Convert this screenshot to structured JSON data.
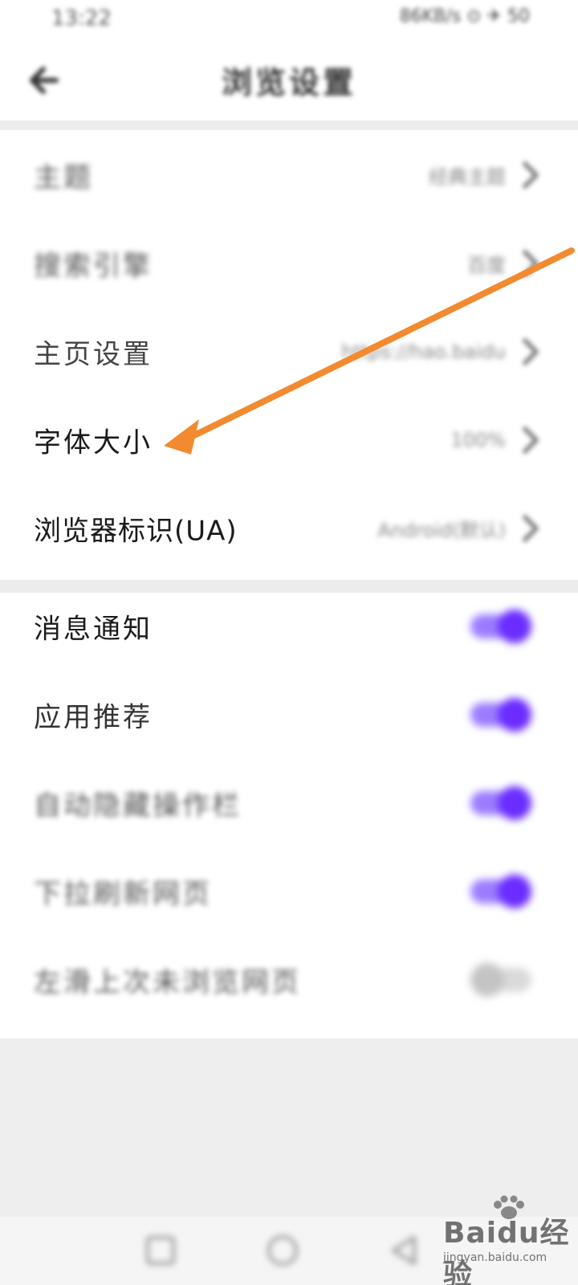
{
  "status_bar": {
    "time": "13:22",
    "icons": "86KB/s ⊙ ✈ 50"
  },
  "header": {
    "title": "浏览设置",
    "back_icon": "back-arrow-icon"
  },
  "settings": {
    "section1": [
      {
        "label": "主题",
        "value": "经典主题",
        "icon": "chevron-right-icon",
        "blurred": true
      },
      {
        "label": "搜索引擎",
        "value": "百度",
        "icon": "chevron-right-icon",
        "blurred": true
      },
      {
        "label": "主页设置",
        "value": "https://hao.baidu",
        "icon": "chevron-right-icon",
        "blurred": false
      },
      {
        "label": "字体大小",
        "value": "100%",
        "icon": "chevron-right-icon",
        "blurred": false
      },
      {
        "label": "浏览器标识(UA)",
        "value": "Android(默认)",
        "icon": "chevron-right-icon",
        "blurred": false
      }
    ],
    "section2": [
      {
        "label": "消息通知",
        "toggle_on": true,
        "blurred": false
      },
      {
        "label": "应用推荐",
        "toggle_on": true,
        "blurred": false
      },
      {
        "label": "自动隐藏操作栏",
        "toggle_on": true,
        "blurred": true
      },
      {
        "label": "下拉刷新网页",
        "toggle_on": true,
        "blurred": true
      },
      {
        "label": "左滑上次未浏览网页",
        "toggle_on": false,
        "blurred": true
      }
    ]
  },
  "navigation": {
    "buttons": [
      "recents-icon",
      "home-icon",
      "back-icon"
    ]
  },
  "watermark": {
    "text": "Baidu经验",
    "sub": "jingyan.baidu.com"
  },
  "colors": {
    "accent": "#7b3cff",
    "annotation_arrow": "#f28a30",
    "background": "#ececec"
  }
}
